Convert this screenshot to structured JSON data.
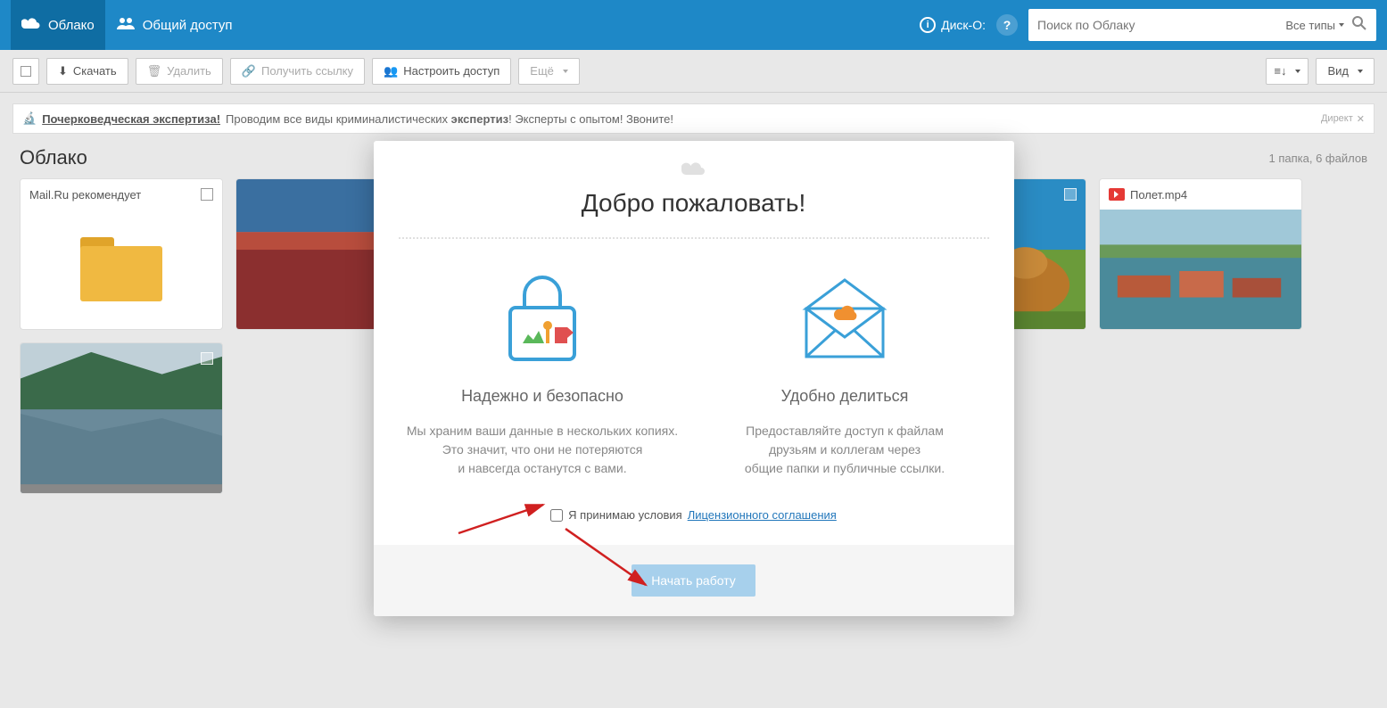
{
  "header": {
    "nav_cloud": "Облако",
    "nav_shared": "Общий доступ",
    "disko": "Диск-О:",
    "search_placeholder": "Поиск по Облаку",
    "search_type": "Все типы"
  },
  "toolbar": {
    "download": "Скачать",
    "delete": "Удалить",
    "get_link": "Получить ссылку",
    "setup_access": "Настроить доступ",
    "more": "Ещё",
    "view": "Вид"
  },
  "ad": {
    "icon": "🔬",
    "title": "Почерковедческая экспертиза!",
    "text_1": "Проводим все виды криминалистических ",
    "bold_1": "экспертиз",
    "text_2": "! Эксперты с опытом! Звоните!",
    "direct": "Директ"
  },
  "content": {
    "title": "Облако",
    "counts": "1 папка, 6 файлов"
  },
  "files": {
    "folder_name": "Mail.Ru рекомендует",
    "video_name": "Полет.mp4"
  },
  "modal": {
    "welcome": "Добро пожаловать!",
    "col1_title": "Надежно и безопасно",
    "col1_line1": "Мы храним ваши данные в нескольких копиях.",
    "col1_line2": "Это значит, что они не потеряются",
    "col1_line3": "и навсегда останутся с вами.",
    "col2_title": "Удобно делиться",
    "col2_line1": "Предоставляйте доступ к файлам",
    "col2_line2": "друзьям и коллегам через",
    "col2_line3": "общие папки и публичные ссылки.",
    "accept": "Я принимаю условия",
    "license": "Лицензионного соглашения",
    "start": "Начать работу"
  }
}
